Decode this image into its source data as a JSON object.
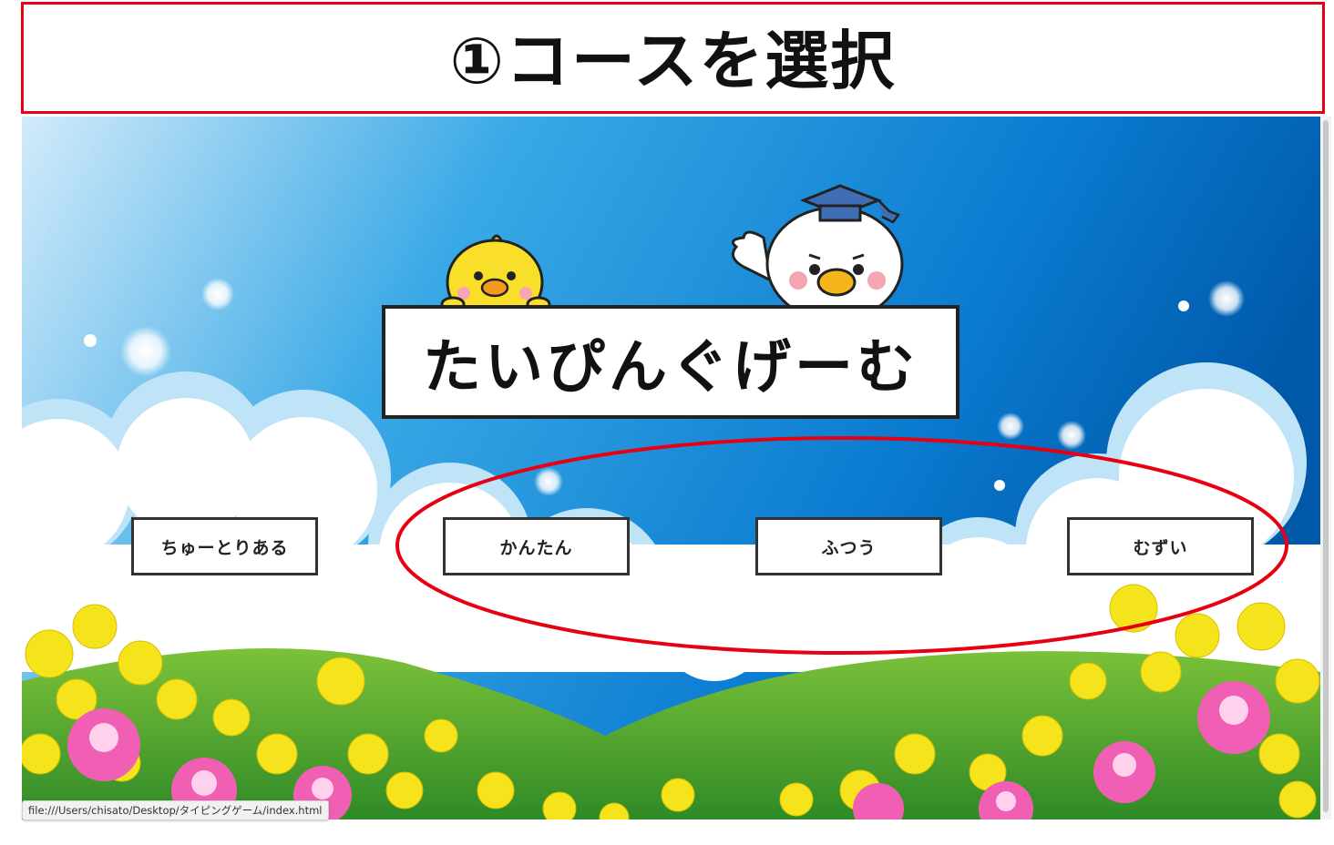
{
  "annotation": {
    "header_title": "①コースを選択"
  },
  "game": {
    "title": "たいぴんぐげーむ"
  },
  "courses": [
    {
      "label": "ちゅーとりある"
    },
    {
      "label": "かんたん"
    },
    {
      "label": "ふつう"
    },
    {
      "label": "むずい"
    }
  ],
  "status_bar": {
    "url": "file:///Users/chisato/Desktop/タイピングゲーム/index.html"
  },
  "colors": {
    "annotation_red": "#e60012",
    "sky_top": "#c9e6f7",
    "sky_deep": "#0068b7",
    "grass": "#3c9a2a",
    "flower_yellow": "#f5e31b",
    "flower_pink": "#f05fb4"
  },
  "icons": [
    "yellow-chick-icon",
    "white-bird-graduate-icon",
    "mortarboard-icon"
  ]
}
